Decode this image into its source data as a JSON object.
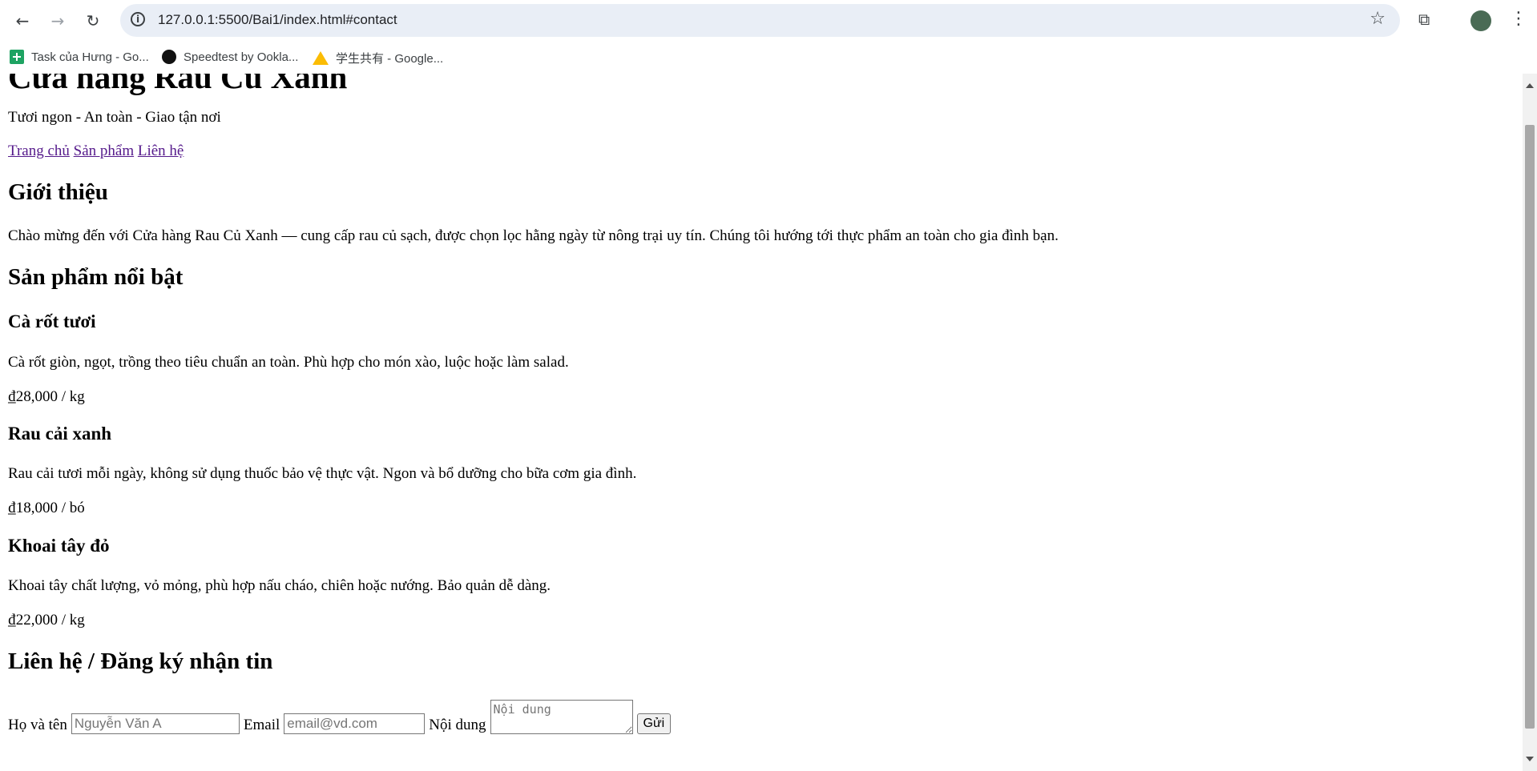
{
  "browser": {
    "url": "127.0.0.1:5500/Bai1/index.html#contact",
    "bookmarks": [
      {
        "label": "Task của Hưng - Go..."
      },
      {
        "label": "Speedtest by Ookla..."
      },
      {
        "label": "学生共有 - Google..."
      }
    ]
  },
  "page": {
    "title": "Cửa hàng Rau Củ Xanh",
    "tagline": "Tươi ngon - An toàn - Giao tận nơi",
    "nav": [
      "Trang chủ",
      "Sản phẩm",
      "Liên hệ"
    ],
    "intro_heading": "Giới thiệu",
    "intro_text": "Chào mừng đến với Cửa hàng Rau Củ Xanh — cung cấp rau củ sạch, được chọn lọc hằng ngày từ nông trại uy tín. Chúng tôi hướng tới thực phẩm an toàn cho gia đình bạn.",
    "products_heading": "Sản phẩm nổi bật",
    "products": [
      {
        "name": "Cà rốt tươi",
        "desc": "Cà rốt giòn, ngọt, trồng theo tiêu chuẩn an toàn. Phù hợp cho món xào, luộc hoặc làm salad.",
        "price": "₫28,000 / kg"
      },
      {
        "name": "Rau cải xanh",
        "desc": "Rau cải tươi mỗi ngày, không sử dụng thuốc bảo vệ thực vật. Ngon và bổ dưỡng cho bữa cơm gia đình.",
        "price": "₫18,000 / bó"
      },
      {
        "name": "Khoai tây đỏ",
        "desc": "Khoai tây chất lượng, vỏ mỏng, phù hợp nấu cháo, chiên hoặc nướng. Bảo quản dễ dàng.",
        "price": "₫22,000 / kg"
      }
    ],
    "contact_heading": "Liên hệ / Đăng ký nhận tin",
    "form": {
      "name_label": "Họ và tên",
      "name_placeholder": "Nguyễn Văn A",
      "email_label": "Email",
      "email_placeholder": "email@vd.com",
      "content_label": "Nội dung",
      "content_placeholder": "Nội dung",
      "submit": "Gửi"
    }
  }
}
